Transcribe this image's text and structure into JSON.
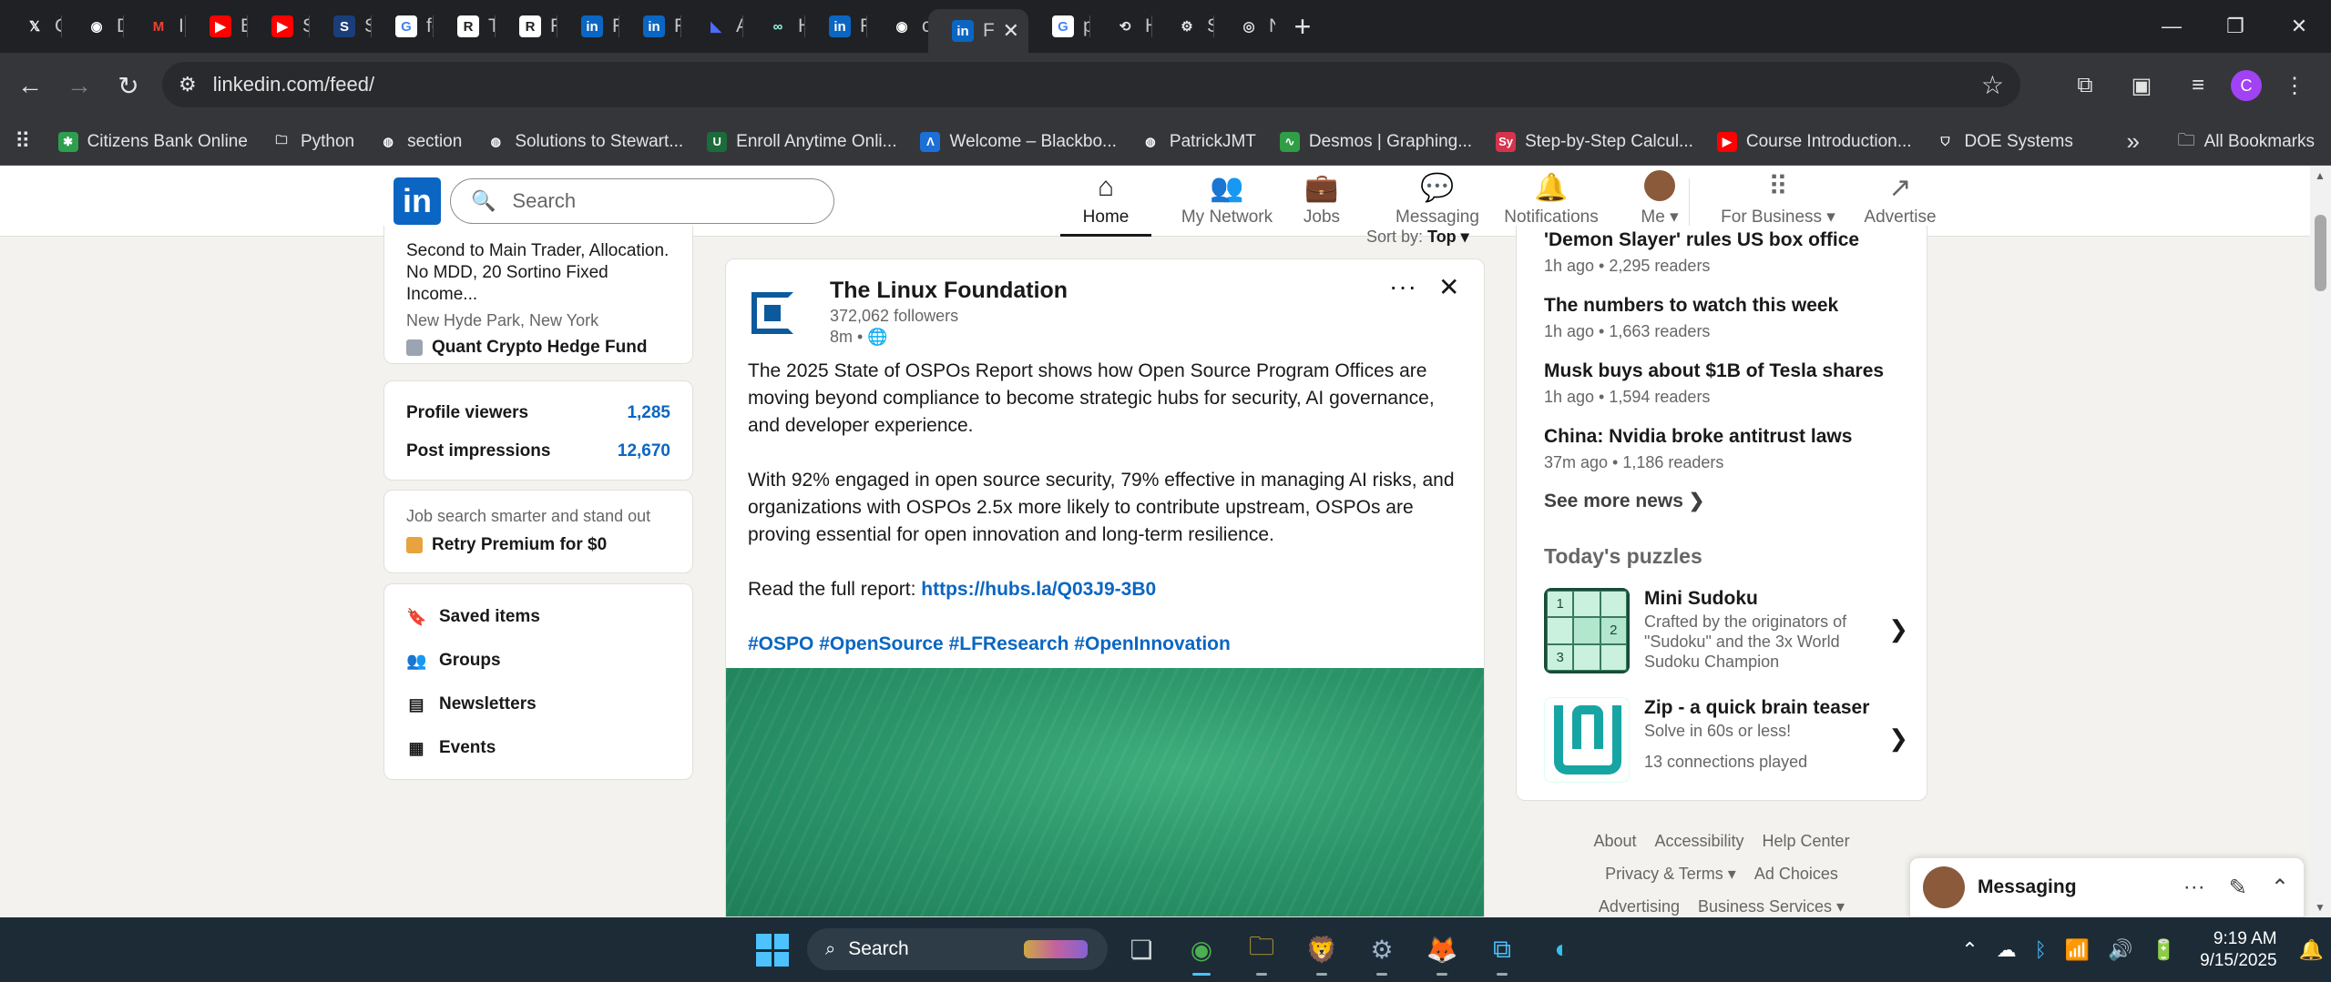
{
  "browser": {
    "tabs": [
      {
        "label": "Calvi",
        "icon": "x-icon",
        "fav_bg": "#202124",
        "fav_fg": "#ffffff",
        "glyph": "𝕏"
      },
      {
        "label": "Depe",
        "icon": "github-icon",
        "fav_bg": "#202124",
        "fav_fg": "#ffffff",
        "glyph": "◉"
      },
      {
        "label": "Inbox",
        "icon": "gmail-icon",
        "fav_bg": "#202124",
        "fav_fg": "#ea4335",
        "glyph": "M"
      },
      {
        "label": "Big S",
        "icon": "youtube-icon",
        "fav_bg": "#ff0000",
        "fav_fg": "#ffffff",
        "glyph": "▶"
      },
      {
        "label": "Steve",
        "icon": "youtube-icon",
        "fav_bg": "#ff0000",
        "fav_fg": "#ffffff",
        "glyph": "▶"
      },
      {
        "label": "Searc",
        "icon": "ssrn-icon",
        "fav_bg": "#1a3e7a",
        "fav_fg": "#ffffff",
        "glyph": "S"
      },
      {
        "label": "forun",
        "icon": "google-icon",
        "fav_bg": "#ffffff",
        "fav_fg": "#4285f4",
        "glyph": "G"
      },
      {
        "label": "The F",
        "icon": "researchgate-icon",
        "fav_bg": "#ffffff",
        "fav_fg": "#202124",
        "glyph": "R"
      },
      {
        "label": "Resea",
        "icon": "researchgate-icon",
        "fav_bg": "#ffffff",
        "fav_fg": "#202124",
        "glyph": "R"
      },
      {
        "label": "Feed",
        "icon": "linkedin-icon",
        "fav_bg": "#0a66c2",
        "fav_fg": "#ffffff",
        "glyph": "in"
      },
      {
        "label": "Feed",
        "icon": "linkedin-icon",
        "fav_bg": "#0a66c2",
        "fav_fg": "#ffffff",
        "glyph": "in"
      },
      {
        "label": "Alter",
        "icon": "alter-icon",
        "fav_bg": "#202124",
        "fav_fg": "#4b6bfb",
        "glyph": "◣"
      },
      {
        "label": "Hype",
        "icon": "hyperliquid-icon",
        "fav_bg": "#202124",
        "fav_fg": "#97fce4",
        "glyph": "∞"
      },
      {
        "label": "Feed",
        "icon": "linkedin-icon",
        "fav_bg": "#0a66c2",
        "fav_fg": "#ffffff",
        "glyph": "in"
      },
      {
        "label": "calvi",
        "icon": "github-icon",
        "fav_bg": "#202124",
        "fav_fg": "#ffffff",
        "glyph": "◉"
      },
      {
        "label": "F",
        "icon": "linkedin-icon",
        "fav_bg": "#0a66c2",
        "fav_fg": "#ffffff",
        "glyph": "in",
        "active": true
      },
      {
        "label": "polyr",
        "icon": "google-icon",
        "fav_bg": "#ffffff",
        "fav_fg": "#4285f4",
        "glyph": "G"
      },
      {
        "label": "Histo",
        "icon": "history-icon",
        "fav_bg": "#202124",
        "fav_fg": "#e3e3e3",
        "glyph": "⟲"
      },
      {
        "label": "Settir",
        "icon": "gear-icon",
        "fav_bg": "#202124",
        "fav_fg": "#e3e3e3",
        "glyph": "⚙"
      },
      {
        "label": "New",
        "icon": "chrome-icon",
        "fav_bg": "#202124",
        "fav_fg": "#e3e3e3",
        "glyph": "◎"
      }
    ],
    "new_tab_glyph": "+",
    "window_controls": {
      "minimize": "—",
      "restore": "❐",
      "close": "✕"
    },
    "url": "linkedin.com/feed/",
    "nav": {
      "back": "←",
      "forward": "→",
      "reload": "↻",
      "site_info": "⚙",
      "star": "☆"
    },
    "profile_initial": "C",
    "bookmarks": [
      {
        "label": "Citizens Bank Online",
        "icon": "citizens-bank-icon",
        "color": "#2e9e4f",
        "glyph": "✱"
      },
      {
        "label": "Python",
        "icon": "folder-icon",
        "color": "#35363a",
        "glyph": "🗀"
      },
      {
        "label": "section",
        "icon": "globe-icon",
        "color": "#35363a",
        "glyph": "◍"
      },
      {
        "label": "Solutions to Stewart...",
        "icon": "globe-icon",
        "color": "#35363a",
        "glyph": "◍"
      },
      {
        "label": "Enroll Anytime Onli...",
        "icon": "uno-icon",
        "color": "#1c6b3a",
        "glyph": "U"
      },
      {
        "label": "Welcome – Blackbo...",
        "icon": "blackboard-icon",
        "color": "#1d6fd8",
        "glyph": "Λ"
      },
      {
        "label": "PatrickJMT",
        "icon": "globe-icon",
        "color": "#35363a",
        "glyph": "◍"
      },
      {
        "label": "Desmos | Graphing...",
        "icon": "desmos-icon",
        "color": "#2f9e44",
        "glyph": "∿"
      },
      {
        "label": "Step-by-Step Calcul...",
        "icon": "symbolab-icon",
        "color": "#d6334d",
        "glyph": "Sy"
      },
      {
        "label": "Course Introduction...",
        "icon": "youtube-icon",
        "color": "#ff0000",
        "glyph": "▶"
      },
      {
        "label": "DOE Systems",
        "icon": "shield-icon",
        "color": "#35363a",
        "glyph": "⛉"
      }
    ],
    "all_bookmarks": "All Bookmarks"
  },
  "linkedin": {
    "logo": "in",
    "search_placeholder": "Search",
    "nav": [
      {
        "label": "Home",
        "icon": "home-icon",
        "glyph": "⌂",
        "active": true
      },
      {
        "label": "My Network",
        "icon": "people-icon",
        "glyph": "👥"
      },
      {
        "label": "Jobs",
        "icon": "briefcase-icon",
        "glyph": "💼"
      },
      {
        "label": "Messaging",
        "icon": "chat-icon",
        "glyph": "💬"
      },
      {
        "label": "Notifications",
        "icon": "bell-icon",
        "glyph": "🔔"
      },
      {
        "label": "Me ▾",
        "icon": "me-avatar"
      },
      {
        "label": "For Business ▾",
        "icon": "grid-icon",
        "glyph": "⠿"
      },
      {
        "label": "Advertise",
        "icon": "advertise-icon",
        "glyph": "↗"
      }
    ],
    "profile_card": {
      "headline": "Second to Main Trader, Allocation. No MDD, 20 Sortino Fixed Income...",
      "location": "New Hyde Park, New York",
      "org": "Quant Crypto Hedge Fund"
    },
    "stats": [
      {
        "label": "Profile viewers",
        "value": "1,285"
      },
      {
        "label": "Post impressions",
        "value": "12,670"
      }
    ],
    "premium": {
      "text": "Job search smarter and stand out",
      "cta": "Retry Premium for $0"
    },
    "shortcuts": [
      {
        "label": "Saved items",
        "icon": "bookmark-icon",
        "glyph": "🔖"
      },
      {
        "label": "Groups",
        "icon": "groups-icon",
        "glyph": "👥"
      },
      {
        "label": "Newsletters",
        "icon": "newsletter-icon",
        "glyph": "▤"
      },
      {
        "label": "Events",
        "icon": "calendar-icon",
        "glyph": "▦"
      }
    ],
    "sort": {
      "label": "Sort by: ",
      "value": "Top ▾"
    },
    "post": {
      "author": "The Linux Foundation",
      "followers": "372,062 followers",
      "time": "8m • 🌐",
      "more": "···",
      "close": "✕",
      "paragraph1": "The 2025 State of OSPOs Report shows how Open Source Program Offices are moving beyond compliance to become strategic hubs for security, AI governance, and developer experience.",
      "paragraph2": "With 92% engaged in open source security, 79% effective in managing AI risks, and organizations with OSPOs 2.5x more likely to contribute upstream, OSPOs are proving essential for open innovation and long-term resilience.",
      "report_prefix": "Read the full report: ",
      "report_link": "https://hubs.la/Q03J9-3B0",
      "hashtags": "#OSPO #OpenSource #LFResearch #OpenInnovation"
    },
    "news": [
      {
        "title": "'Demon Slayer' rules US box office",
        "meta": "1h ago • 2,295 readers"
      },
      {
        "title": "The numbers to watch this week",
        "meta": "1h ago • 1,663 readers"
      },
      {
        "title": "Musk buys about $1B of Tesla shares",
        "meta": "1h ago • 1,594 readers"
      },
      {
        "title": "China: Nvidia broke antitrust laws",
        "meta": "37m ago • 1,186 readers"
      }
    ],
    "see_more": "See more news ❯",
    "puzzles_heading": "Today's puzzles",
    "puzzles": [
      {
        "title": "Mini Sudoku",
        "sub": "Crafted by the originators of \"Sudoku\" and the 3x World Sudoku Champion",
        "cells": [
          "1",
          "",
          "",
          "",
          "",
          "2",
          "3",
          "",
          ""
        ]
      },
      {
        "title": "Zip - a quick brain teaser",
        "sub": "Solve in 60s or less!",
        "extra": "13 connections played"
      }
    ],
    "footer": {
      "row1": [
        "About",
        "Accessibility",
        "Help Center"
      ],
      "row2": [
        "Privacy & Terms ▾",
        "Ad Choices"
      ],
      "row3": [
        "Advertising",
        "Business Services ▾"
      ]
    },
    "messaging": {
      "label": "Messaging",
      "more": "···",
      "compose": "✎",
      "collapse": "⌃"
    }
  },
  "taskbar": {
    "search": "Search",
    "apps": [
      {
        "name": "task-view-icon",
        "glyph": "❏",
        "color": "#cfd8dc"
      },
      {
        "name": "chrome-icon",
        "glyph": "◉",
        "color": "#4caf50",
        "state": "focused"
      },
      {
        "name": "file-explorer-icon",
        "glyph": "🗀",
        "color": "#f4c430",
        "state": "open"
      },
      {
        "name": "brave-icon",
        "glyph": "🦁",
        "color": "#fb542b",
        "state": "open"
      },
      {
        "name": "settings-icon",
        "glyph": "⚙",
        "color": "#9fb3c8",
        "state": "open"
      },
      {
        "name": "firefox-icon",
        "glyph": "🦊",
        "color": "#ff7139",
        "state": "open"
      },
      {
        "name": "vscode-icon",
        "glyph": "⧉",
        "color": "#4cc2ff",
        "state": "open"
      },
      {
        "name": "edge-icon",
        "glyph": "◐",
        "color": "#34c0eb"
      }
    ],
    "tray": {
      "chevron": "⌃",
      "cloud": "☁",
      "bluetooth": "ᛒ",
      "wifi": "📶",
      "volume": "🔊",
      "battery": "🔋",
      "time": "9:19 AM",
      "date": "9/15/2025",
      "bell": "🔔"
    }
  }
}
